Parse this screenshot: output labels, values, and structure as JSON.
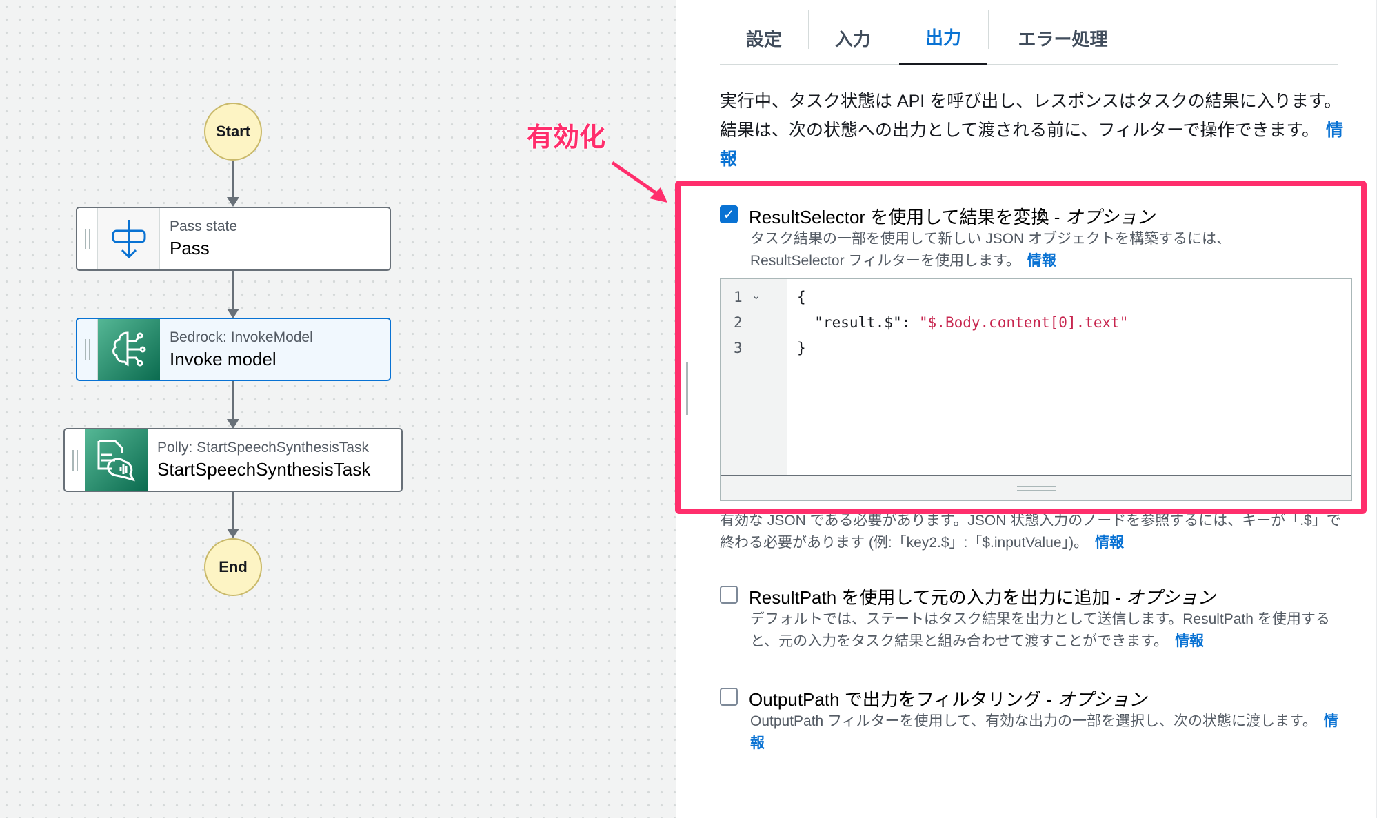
{
  "workflow": {
    "start_label": "Start",
    "end_label": "End",
    "nodes": [
      {
        "type": "Pass state",
        "name": "Pass",
        "icon": "pass-state-icon"
      },
      {
        "type": "Bedrock: InvokeModel",
        "name": "Invoke model",
        "icon": "bedrock-brain-icon",
        "selected": true
      },
      {
        "type": "Polly: StartSpeechSynthesisTask",
        "name": "StartSpeechSynthesisTask",
        "icon": "polly-speech-icon"
      }
    ]
  },
  "tabs": [
    {
      "label": "設定"
    },
    {
      "label": "入力"
    },
    {
      "label": "出力",
      "active": true
    },
    {
      "label": "エラー処理"
    }
  ],
  "description": "実行中、タスク状態は API を呼び出し、レスポンスはタスクの結果に入ります。結果は、次の状態への出力として渡される前に、フィルターで操作できます。",
  "info_label": "情報",
  "annotation": "有効化",
  "annotation_color": "#ff2e6c",
  "result_selector": {
    "checked": true,
    "label": "ResultSelector を使用して結果を変換 - ",
    "optional": "オプション",
    "description": "タスク結果の一部を使用して新しい JSON オブジェクトを構築するには、ResultSelector フィルターを使用します。",
    "code": {
      "line_numbers": [
        "1",
        "2",
        "3"
      ],
      "line1": "{",
      "key": "  \"result.$\": ",
      "value": "\"$.Body.content[0].text\"",
      "line3": "}"
    },
    "help": "有効な JSON である必要があります。JSON 状態入力のノードを参照するには、キーが「.$」で終わる必要があります (例:「key2.$」:「$.inputValue」)。"
  },
  "result_path": {
    "checked": false,
    "label": "ResultPath を使用して元の入力を出力に追加 - ",
    "optional": "オプション",
    "description": "デフォルトでは、ステートはタスク結果を出力として送信します。ResultPath を使用すると、元の入力をタスク結果と組み合わせて渡すことができます。"
  },
  "output_path": {
    "checked": false,
    "label": "OutputPath で出力をフィルタリング - ",
    "optional": "オプション",
    "description": "OutputPath フィルターを使用して、有効な出力の一部を選択し、次の状態に渡します。"
  }
}
